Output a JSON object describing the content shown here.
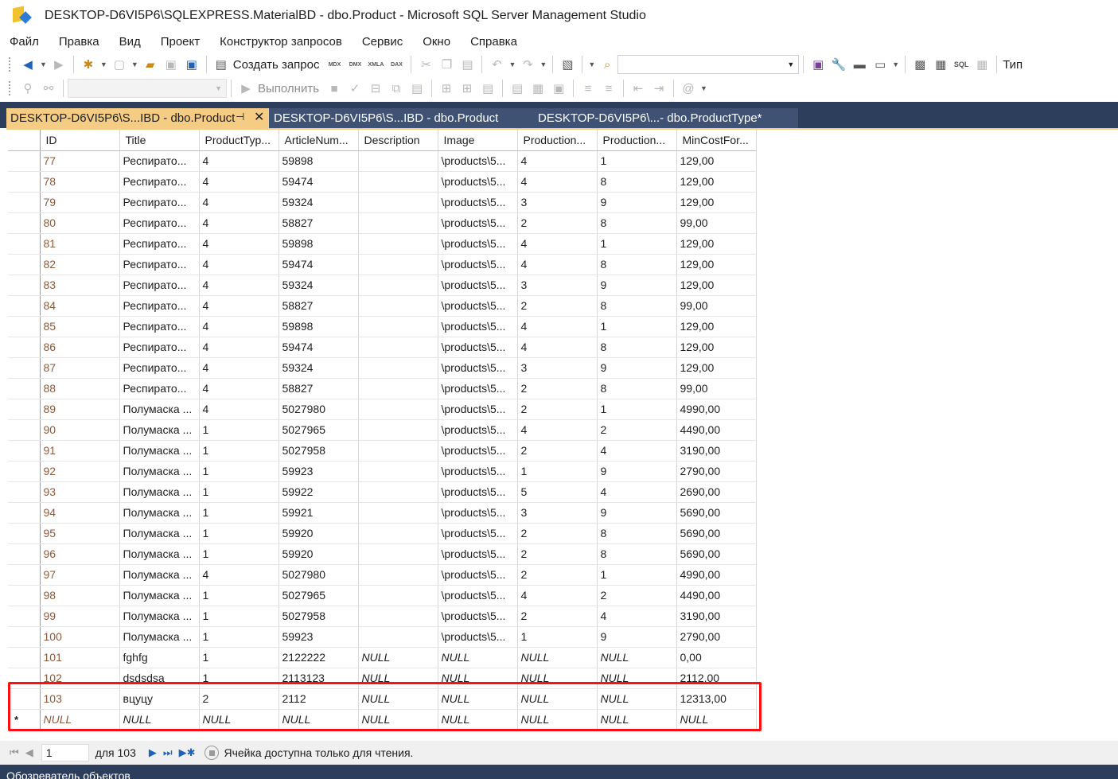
{
  "window": {
    "title": "DESKTOP-D6VI5P6\\SQLEXPRESS.MaterialBD - dbo.Product - Microsoft SQL Server Management Studio"
  },
  "menu": [
    "Файл",
    "Правка",
    "Вид",
    "Проект",
    "Конструктор запросов",
    "Сервис",
    "Окно",
    "Справка"
  ],
  "toolbar": {
    "new_query_label": "Создать запрос",
    "execute_label": "Выполнить",
    "mdx_label": "MDX",
    "dmx_label": "DMX",
    "xmla_label": "XMLA",
    "dax_label": "DAX",
    "sql_label": "SQL",
    "overflow_label": "Тип"
  },
  "tabs": [
    {
      "label": "DESKTOP-D6VI5P6\\S...IBD - dbo.Product",
      "active": true
    },
    {
      "label": "DESKTOP-D6VI5P6\\S...IBD - dbo.Product",
      "active": false
    },
    {
      "label": "DESKTOP-D6VI5P6\\...- dbo.ProductType*",
      "active": false
    }
  ],
  "grid": {
    "columns": [
      "ID",
      "Title",
      "ProductTyp...",
      "ArticleNum...",
      "Description",
      "Image",
      "Production...",
      "Production...",
      "MinCostFor..."
    ],
    "rows": [
      {
        "marker": "",
        "cells": [
          "77",
          "Респирато...",
          "4",
          "59898",
          "",
          "\\products\\5...",
          "4",
          "1",
          "129,00"
        ]
      },
      {
        "marker": "",
        "cells": [
          "78",
          "Респирато...",
          "4",
          "59474",
          "",
          "\\products\\5...",
          "4",
          "8",
          "129,00"
        ]
      },
      {
        "marker": "",
        "cells": [
          "79",
          "Респирато...",
          "4",
          "59324",
          "",
          "\\products\\5...",
          "3",
          "9",
          "129,00"
        ]
      },
      {
        "marker": "",
        "cells": [
          "80",
          "Респирато...",
          "4",
          "58827",
          "",
          "\\products\\5...",
          "2",
          "8",
          "99,00"
        ]
      },
      {
        "marker": "",
        "cells": [
          "81",
          "Респирато...",
          "4",
          "59898",
          "",
          "\\products\\5...",
          "4",
          "1",
          "129,00"
        ]
      },
      {
        "marker": "",
        "cells": [
          "82",
          "Респирато...",
          "4",
          "59474",
          "",
          "\\products\\5...",
          "4",
          "8",
          "129,00"
        ]
      },
      {
        "marker": "",
        "cells": [
          "83",
          "Респирато...",
          "4",
          "59324",
          "",
          "\\products\\5...",
          "3",
          "9",
          "129,00"
        ]
      },
      {
        "marker": "",
        "cells": [
          "84",
          "Респирато...",
          "4",
          "58827",
          "",
          "\\products\\5...",
          "2",
          "8",
          "99,00"
        ]
      },
      {
        "marker": "",
        "cells": [
          "85",
          "Респирато...",
          "4",
          "59898",
          "",
          "\\products\\5...",
          "4",
          "1",
          "129,00"
        ]
      },
      {
        "marker": "",
        "cells": [
          "86",
          "Респирато...",
          "4",
          "59474",
          "",
          "\\products\\5...",
          "4",
          "8",
          "129,00"
        ]
      },
      {
        "marker": "",
        "cells": [
          "87",
          "Респирато...",
          "4",
          "59324",
          "",
          "\\products\\5...",
          "3",
          "9",
          "129,00"
        ]
      },
      {
        "marker": "",
        "cells": [
          "88",
          "Респирато...",
          "4",
          "58827",
          "",
          "\\products\\5...",
          "2",
          "8",
          "99,00"
        ]
      },
      {
        "marker": "",
        "cells": [
          "89",
          "Полумаска ...",
          "4",
          "5027980",
          "",
          "\\products\\5...",
          "2",
          "1",
          "4990,00"
        ]
      },
      {
        "marker": "",
        "cells": [
          "90",
          "Полумаска ...",
          "1",
          "5027965",
          "",
          "\\products\\5...",
          "4",
          "2",
          "4490,00"
        ]
      },
      {
        "marker": "",
        "cells": [
          "91",
          "Полумаска ...",
          "1",
          "5027958",
          "",
          "\\products\\5...",
          "2",
          "4",
          "3190,00"
        ]
      },
      {
        "marker": "",
        "cells": [
          "92",
          "Полумаска ...",
          "1",
          "59923",
          "",
          "\\products\\5...",
          "1",
          "9",
          "2790,00"
        ]
      },
      {
        "marker": "",
        "cells": [
          "93",
          "Полумаска ...",
          "1",
          "59922",
          "",
          "\\products\\5...",
          "5",
          "4",
          "2690,00"
        ]
      },
      {
        "marker": "",
        "cells": [
          "94",
          "Полумаска ...",
          "1",
          "59921",
          "",
          "\\products\\5...",
          "3",
          "9",
          "5690,00"
        ]
      },
      {
        "marker": "",
        "cells": [
          "95",
          "Полумаска ...",
          "1",
          "59920",
          "",
          "\\products\\5...",
          "2",
          "8",
          "5690,00"
        ]
      },
      {
        "marker": "",
        "cells": [
          "96",
          "Полумаска ...",
          "1",
          "59920",
          "",
          "\\products\\5...",
          "2",
          "8",
          "5690,00"
        ]
      },
      {
        "marker": "",
        "cells": [
          "97",
          "Полумаска ...",
          "4",
          "5027980",
          "",
          "\\products\\5...",
          "2",
          "1",
          "4990,00"
        ]
      },
      {
        "marker": "",
        "cells": [
          "98",
          "Полумаска ...",
          "1",
          "5027965",
          "",
          "\\products\\5...",
          "4",
          "2",
          "4490,00"
        ]
      },
      {
        "marker": "",
        "cells": [
          "99",
          "Полумаска ...",
          "1",
          "5027958",
          "",
          "\\products\\5...",
          "2",
          "4",
          "3190,00"
        ]
      },
      {
        "marker": "",
        "cells": [
          "100",
          "Полумаска ...",
          "1",
          "59923",
          "",
          "\\products\\5...",
          "1",
          "9",
          "2790,00"
        ]
      },
      {
        "marker": "",
        "cells": [
          "101",
          "fghfg",
          "1",
          "2122222",
          "NULL",
          "NULL",
          "NULL",
          "NULL",
          "0,00"
        ]
      },
      {
        "marker": "",
        "cells": [
          "102",
          "dsdsdsa",
          "1",
          "2113123",
          "NULL",
          "NULL",
          "NULL",
          "NULL",
          "2112,00"
        ]
      },
      {
        "marker": "",
        "cells": [
          "103",
          "вцуцу",
          "2",
          "2112",
          "NULL",
          "NULL",
          "NULL",
          "NULL",
          "12313,00"
        ]
      },
      {
        "marker": "*",
        "cells": [
          "NULL",
          "NULL",
          "NULL",
          "NULL",
          "NULL",
          "NULL",
          "NULL",
          "NULL",
          "NULL"
        ]
      }
    ]
  },
  "navigator": {
    "current": "1",
    "of_label": "для 103",
    "status": "Ячейка доступна только для чтения."
  },
  "statusbar": {
    "text": "Обозреватель объектов"
  },
  "colors": {
    "accent_tab": "#f5cc84",
    "chrome_dark": "#2d3e5c",
    "highlight_box": "#ff1010",
    "id_text": "#8b5a3c"
  }
}
